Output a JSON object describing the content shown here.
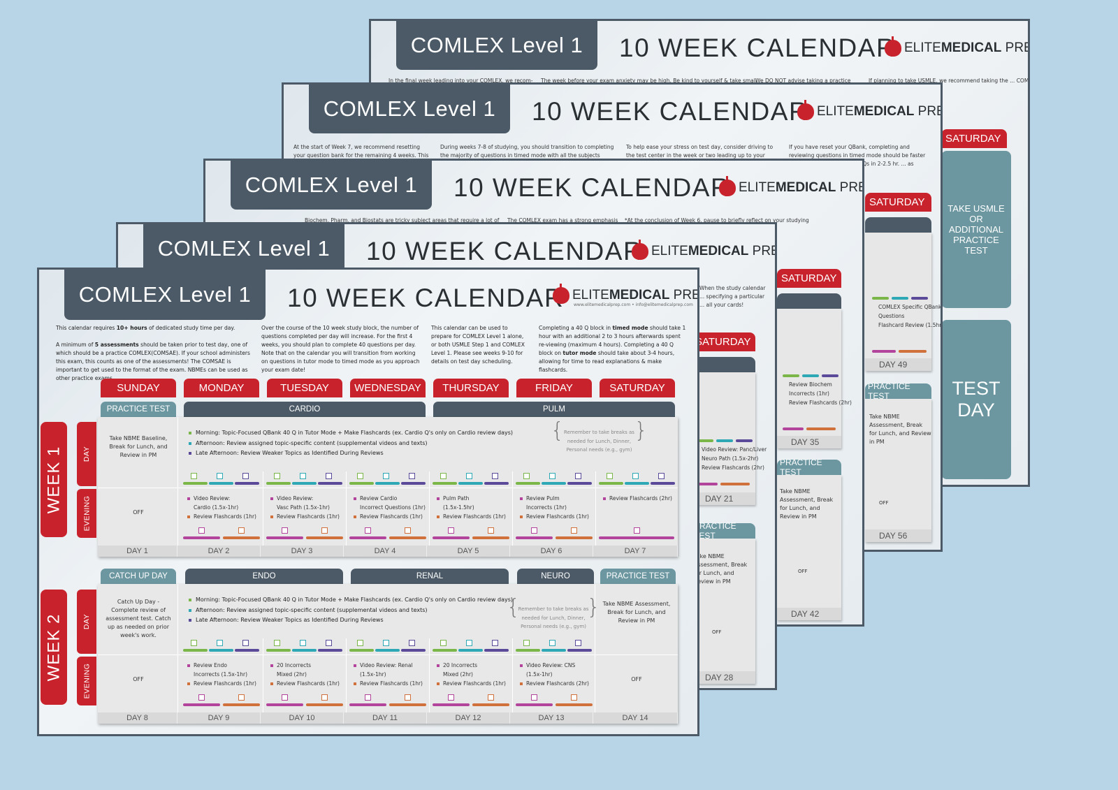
{
  "header": {
    "exam_title": "COMLEX Level 1",
    "calendar_title": "10 WEEK CALENDAR",
    "brand_elite": "ELITE",
    "brand_medical": "MEDICAL",
    "brand_prep": "PREP",
    "brand_contact": "www.elitemedicalprep.com  •  info@elitemedicalprep.com"
  },
  "intro": {
    "col1_p1_pre": "This calendar requires ",
    "col1_p1_bold": "10+ hours",
    "col1_p1_post": " of dedicated study time per day.",
    "col1_p2_pre": "A minimum of ",
    "col1_p2_bold": "5 assessments",
    "col1_p2_post": " should be taken prior to test day, one of which should be a practice COMLEX(COMSAE). If your school administers this exam, this counts as one of the assessments! The COMSAE is important to get used to the format of the exam. NBMEs can be used as other practice exams.",
    "col2": "Over the course of the 10 week study block, the number of questions completed per day will increase. For the first 4 weeks, you should plan to complete 40 questions per day. Note that on the calendar you will transition from working on questions in tutor mode to timed mode as you approach your exam date!",
    "col3": "This calendar can be used to prepare for COMLEX Level 1 alone, or both USMLE Step 1 and COMLEX Level 1. Please see weeks 9-10 for details on test day scheduling.",
    "col4_pre": "Completing a 40 Q block in ",
    "col4_bold1": "timed mode",
    "col4_mid": " should take 1 hour with an additional 2 to 3 hours afterwards spent re-viewing (maximum 4 hours). Completing a 40 Q block on ",
    "col4_bold2": "tutor mode",
    "col4_post": " should take about 3-4 hours, allowing for time to read explanations & make flashcards."
  },
  "days": [
    "SUNDAY",
    "MONDAY",
    "TUESDAY",
    "WEDNESDAY",
    "THURSDAY",
    "FRIDAY",
    "SATURDAY"
  ],
  "row_labels": {
    "day": "DAY",
    "evening": "EVENING"
  },
  "daily_plan": {
    "morning": "Morning: Topic-Focused QBank 40 Q in Tutor Mode + Make Flashcards (ex. Cardio Q's only on Cardio review days)",
    "afternoon": "Afternoon: Review assigned topic-specific content (supplemental videos and texts)",
    "late_afternoon": "Late Afternoon: Review Weaker Topics as Identified During Reviews",
    "reminder": "Remember to take breaks as needed for Lunch, Dinner, Personal needs (e.g., gym)"
  },
  "weeks": [
    {
      "label": "WEEK 1",
      "topics": [
        {
          "label": "PRACTICE TEST",
          "style": "teal"
        },
        {
          "label": "CARDIO",
          "style": "dark"
        },
        {
          "label": "PULM",
          "style": "dark"
        }
      ],
      "sunday_day": "Take NBME Baseline, Break for Lunch, and Review in PM",
      "sunday_evening": "OFF",
      "evenings": [
        [
          "Video Review:",
          "Cardio (1.5x-1hr)",
          "Review Flashcards (1hr)"
        ],
        [
          "Video Review:",
          "Vasc Path (1.5x-1hr)",
          "Review Flashcards (1hr)"
        ],
        [
          "Review Cardio",
          "Incorrect Questions (1hr)",
          "Review Flashcards (1hr)"
        ],
        [
          "Pulm Path",
          "(1.5x-1.5hr)",
          "Review Flashcards (1hr)"
        ],
        [
          "Review Pulm",
          "Incorrects (1hr)",
          "Review Flashcards (1hr)"
        ],
        [
          "Review Flashcards (2hr)"
        ]
      ],
      "day_numbers": [
        "DAY 1",
        "DAY 2",
        "DAY 3",
        "DAY 4",
        "DAY 5",
        "DAY 6",
        "DAY 7"
      ]
    },
    {
      "label": "WEEK 2",
      "topics": [
        {
          "label": "CATCH UP DAY",
          "style": "teal"
        },
        {
          "label": "ENDO",
          "style": "dark"
        },
        {
          "label": "RENAL",
          "style": "dark"
        },
        {
          "label": "NEURO",
          "style": "dark"
        },
        {
          "label": "PRACTICE TEST",
          "style": "teal"
        }
      ],
      "sunday_day": "Catch Up Day - Complete review of assessment test. Catch up as needed on prior week's work.",
      "sunday_evening": "OFF",
      "saturday_day": "Take NBME Assessment, Break for Lunch, and Review in PM",
      "saturday_evening": "OFF",
      "evenings": [
        [
          "Review Endo",
          "Incorrects (1.5x-1hr)",
          "Review Flashcards (1hr)"
        ],
        [
          "20 Incorrects",
          "Mixed (2hr)",
          "Review Flashcards (1hr)"
        ],
        [
          "Video Review: Renal",
          "(1.5x-1hr)",
          "Review Flashcards (1hr)"
        ],
        [
          "20 Incorrects",
          "Mixed (2hr)",
          "Review Flashcards (1hr)"
        ],
        [
          "Video Review: CNS",
          "(1.5x-1hr)",
          "Review Flashcards (2hr)"
        ]
      ],
      "day_numbers": [
        "DAY 8",
        "DAY 9",
        "DAY 10",
        "DAY 11",
        "DAY 12",
        "DAY 13",
        "DAY 14"
      ]
    }
  ],
  "back_sheets": {
    "sheet2": {
      "intro_fragment": "When the study calendar ... specifying a particular ... all your cards!",
      "saturday": "SATURDAY",
      "evening_fragment": [
        "Video Review: Panc/Liver",
        "Neuro Path (1.5x-2hr)",
        "Review Flashcards (2hr)"
      ],
      "day_a": "DAY 21",
      "practice_test": "PRACTICE TEST",
      "practice_text": "Take NBME Assessment, Break for Lunch, and Review in PM",
      "off": "OFF",
      "day_b": "DAY 28"
    },
    "sheet3": {
      "intro": [
        "Biochem, Pharm, and Biostats are tricky subject areas that require a lot of",
        "The COMLEX exam has a strong emphasis",
        "*At the conclusion of Week 6, pause to briefly reflect on your studying"
      ],
      "saturday": "SATURDAY",
      "evening_fragment": [
        "Review Biochem",
        "Incorrects (1hr)",
        "Review Flashcards (2hr)"
      ],
      "day_a": "DAY 35",
      "practice_test": "PRACTICE TEST",
      "practice_text": "Take NBME Assessment, Break for Lunch, and Review in PM",
      "off": "OFF",
      "day_b": "DAY 42"
    },
    "sheet4": {
      "intro": [
        "At the start of Week 7, we recommend resetting your question bank for the remaining 4 weeks. This will help",
        "During weeks 7-8 of studying, you should transition to completing the majority of questions in timed mode with all the subjects mixed! Start",
        "To help ease your stress on test day, consider driving to the test center in the week or two leading up to your official test",
        "If you have reset your QBank, completing and reviewing questions in timed mode should be faster than the 1st ... blocks of 40 Qs in 2-2.5 hr. ... as needed."
      ],
      "saturday": "SATURDAY",
      "evening_fragment": [
        "COMLEX Specific QBank:",
        "Questions",
        "Flashcard Review (1.5hr)"
      ],
      "day_a": "DAY 49",
      "practice_test": "PRACTICE TEST",
      "practice_text": "Take NBME Assessment, Break for Lunch, and Review in PM",
      "off": "OFF",
      "day_b": "DAY 56"
    },
    "sheet5": {
      "intro": [
        "In the final week leading into your COMLEX, we recom-",
        "The week before your exam anxiety may be high. Be kind to yourself & take small",
        "We DO NOT advise taking a practice",
        "If planning to take USMLE, we recommend taking the ... COMLEX. We recommend ... your USMLE and then using 4 ..."
      ],
      "saturday": "SATURDAY",
      "usmle_box": "TAKE USMLE OR ADDITIONAL PRACTICE TEST",
      "test_day": "TEST DAY"
    }
  },
  "colors": {
    "red": "#c8232c",
    "slate": "#4b5a66",
    "teal": "#6c97a1",
    "background": "#b7d5e6",
    "check_green": "#7ab648",
    "check_cyan": "#2fa8b5",
    "check_purple": "#5b4a9a",
    "check_magenta": "#b3449b",
    "check_orange": "#d0703a"
  }
}
